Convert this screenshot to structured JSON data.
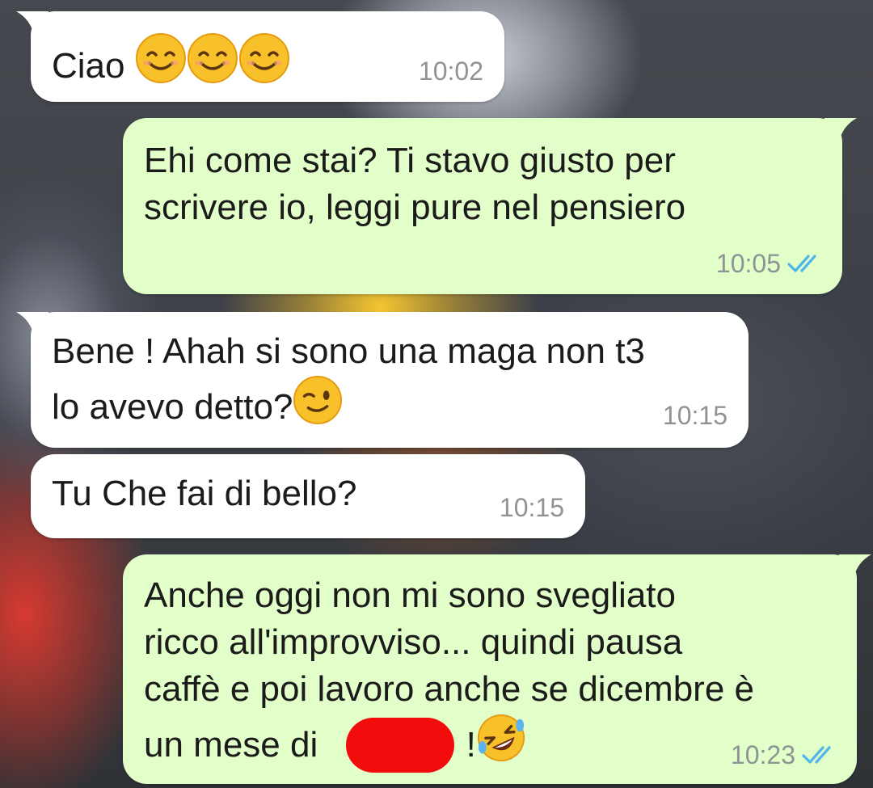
{
  "conversation": {
    "messages": [
      {
        "direction": "incoming",
        "text": "Ciao",
        "emoji": [
          "smiling-face-with-smiling-eyes",
          "smiling-face-with-smiling-eyes",
          "smiling-face-with-smiling-eyes"
        ],
        "time": "10:02"
      },
      {
        "direction": "outgoing",
        "line1": "Ehi come stai? Ti stavo giusto per",
        "line2": "scrivere io, leggi pure nel pensiero",
        "time": "10:05",
        "status": "read"
      },
      {
        "direction": "incoming",
        "line1": "Bene ! Ahah si sono una maga non t3",
        "line2": "lo avevo detto?",
        "emoji": [
          "winking-face"
        ],
        "time": "10:15"
      },
      {
        "direction": "incoming",
        "text": "Tu Che fai di bello?",
        "time": "10:15"
      },
      {
        "direction": "outgoing",
        "line1": "Anche oggi non mi sono svegliato",
        "line2": "ricco all'improvviso... quindi pausa",
        "line3": "caffè e poi lavoro anche se dicembre è",
        "line4": "un mese di",
        "line4_end": "!",
        "emoji": [
          "rolling-on-the-floor-laughing"
        ],
        "time": "10:23",
        "status": "read"
      }
    ]
  },
  "colors": {
    "incoming_bubble": "#ffffff",
    "outgoing_bubble": "#e2ffc9",
    "timestamp": "#8e9396",
    "read_ticks": "#4fb6ec",
    "redaction": "#f20c0c"
  }
}
